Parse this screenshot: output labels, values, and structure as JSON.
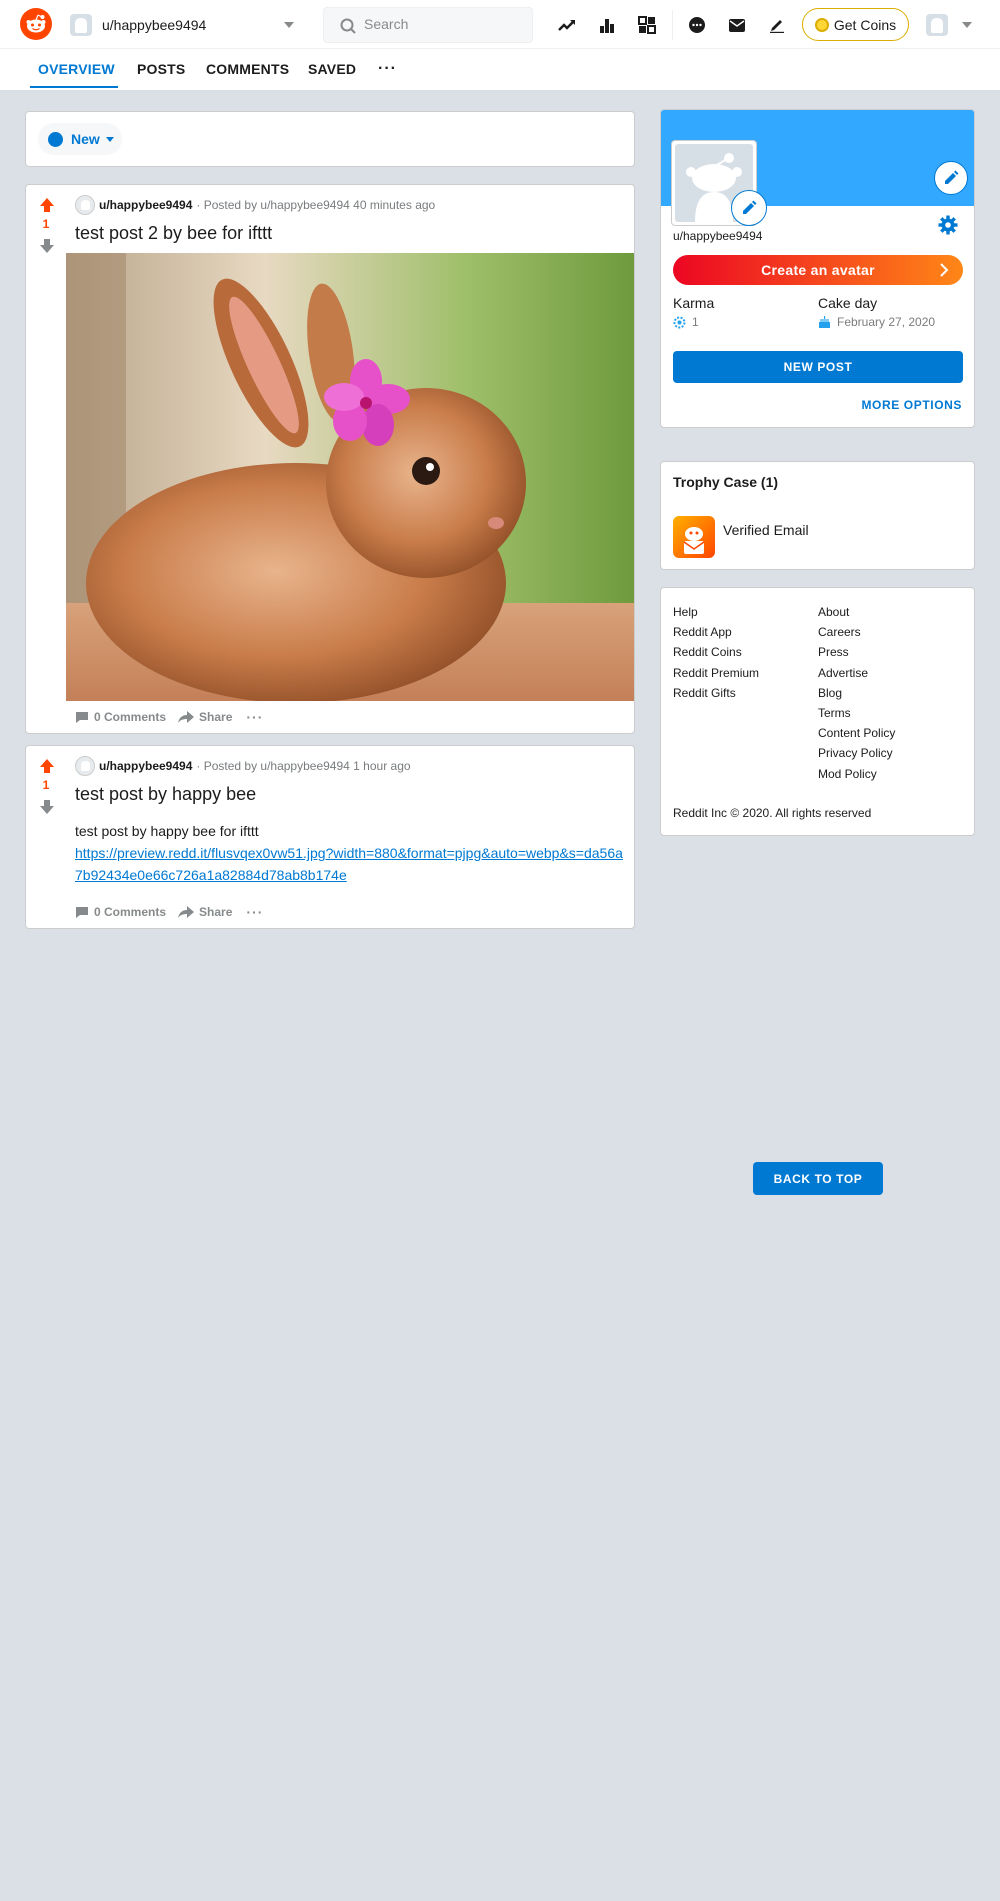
{
  "header": {
    "username": "u/happybee9494",
    "search_placeholder": "Search",
    "coins_label": "Get Coins"
  },
  "tabs": [
    {
      "label": "OVERVIEW",
      "active": true
    },
    {
      "label": "POSTS"
    },
    {
      "label": "COMMENTS"
    },
    {
      "label": "SAVED"
    }
  ],
  "sort": {
    "label": "New"
  },
  "posts": [
    {
      "score": "1",
      "subreddit": "u/happybee9494",
      "posted_by": "· Posted by u/happybee9494 40 minutes ago",
      "title": "test post 2 by bee for ifttt",
      "comments": "0 Comments",
      "share": "Share"
    },
    {
      "score": "1",
      "subreddit": "u/happybee9494",
      "posted_by": "· Posted by u/happybee9494 1 hour ago",
      "title": "test post by happy bee",
      "body": "test post by happy bee for ifttt",
      "link": "https://preview.redd.it/flusvqex0vw51.jpg?width=880&format=pjpg&auto=webp&s=da56a7b92434e0e66c726a1a82884d78ab8b174e",
      "comments": "0 Comments",
      "share": "Share"
    }
  ],
  "profile": {
    "username": "u/happybee9494",
    "create_avatar": "Create an avatar",
    "karma_label": "Karma",
    "karma_value": "1",
    "cakeday_label": "Cake day",
    "cakeday_value": "February 27, 2020",
    "new_post": "NEW POST",
    "more_options": "MORE OPTIONS"
  },
  "trophy": {
    "title": "Trophy Case (1)",
    "item": "Verified Email"
  },
  "links": {
    "left": [
      "Help",
      "Reddit App",
      "Reddit Coins",
      "Reddit Premium",
      "Reddit Gifts"
    ],
    "right": [
      "About",
      "Careers",
      "Press",
      "Advertise",
      "Blog",
      "Terms",
      "Content Policy",
      "Privacy Policy",
      "Mod Policy"
    ],
    "copyright": "Reddit Inc © 2020. All rights reserved"
  },
  "back_to_top": "BACK TO TOP",
  "colors": {
    "brand": "#ff4500",
    "accent": "#0079d3",
    "banner": "#33a8ff",
    "page_bg": "#dae0e6"
  }
}
